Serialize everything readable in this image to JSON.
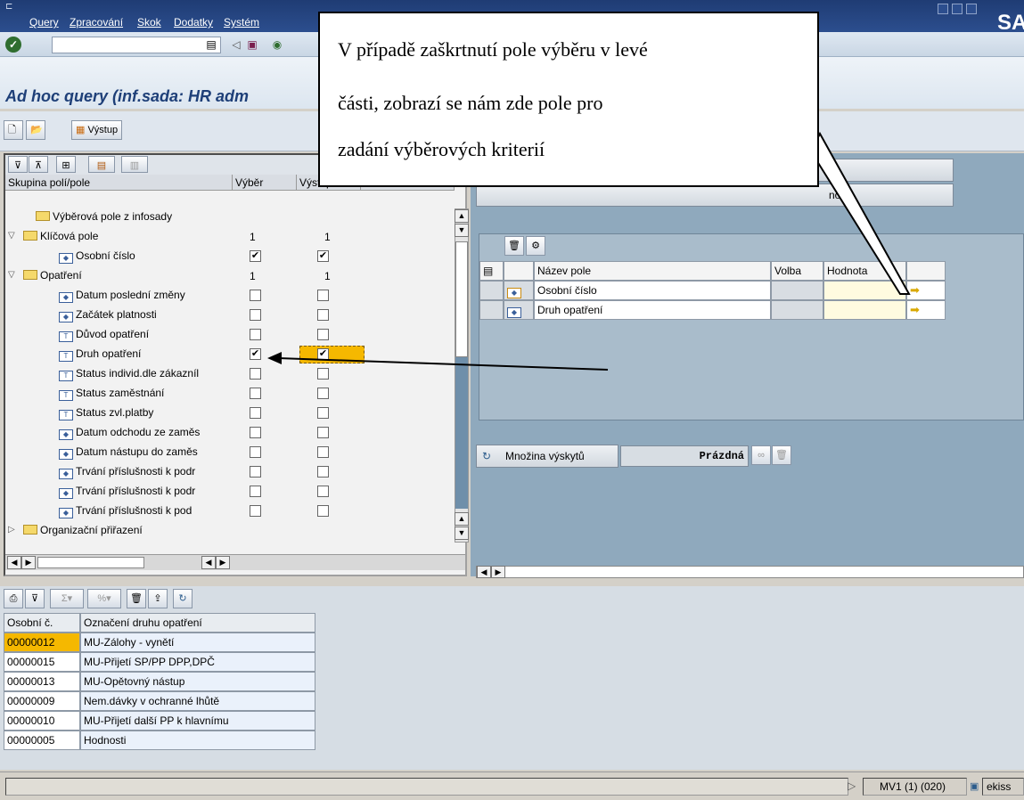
{
  "menubar": {
    "items": [
      "Query",
      "Zpracování",
      "Skok",
      "Dodatky",
      "Systém"
    ],
    "logo": "SA"
  },
  "title": "Ad hoc query (inf.sada: HR adm",
  "app_toolbar": {
    "output_button": "Výstup"
  },
  "left_panel": {
    "columns": [
      "Skupina polí/pole",
      "Výběr",
      "Výstup"
    ],
    "rows": [
      {
        "label": "Výběrová pole z infosady",
        "type": "folder",
        "indent": 1
      },
      {
        "label": "Klíčová pole",
        "type": "folder-open",
        "indent": 0,
        "sel": "1",
        "out": "1"
      },
      {
        "label": "Osobní číslo",
        "type": "field",
        "indent": 2,
        "sel_cb": true,
        "out_cb": true
      },
      {
        "label": "Opatření",
        "type": "folder-open",
        "indent": 0,
        "sel": "1",
        "out": "1"
      },
      {
        "label": "Datum poslední změny",
        "type": "field",
        "indent": 2,
        "sel_cb": false,
        "out_cb": false
      },
      {
        "label": "Začátek platnosti",
        "type": "field",
        "indent": 2,
        "sel_cb": false,
        "out_cb": false
      },
      {
        "label": "Důvod opatření",
        "type": "field-t",
        "indent": 2,
        "sel_cb": false,
        "out_cb": false
      },
      {
        "label": "Druh opatření",
        "type": "field-t",
        "indent": 2,
        "sel_cb": true,
        "out_cb": true
      },
      {
        "label": "Status individ.dle zákazníl",
        "type": "field-t",
        "indent": 2,
        "sel_cb": false,
        "out_cb": false
      },
      {
        "label": "Status zaměstnání",
        "type": "field-t",
        "indent": 2,
        "sel_cb": false,
        "out_cb": false
      },
      {
        "label": "Status zvl.platby",
        "type": "field-t",
        "indent": 2,
        "sel_cb": false,
        "out_cb": false
      },
      {
        "label": "Datum odchodu ze zaměs",
        "type": "field",
        "indent": 2,
        "sel_cb": false,
        "out_cb": false
      },
      {
        "label": "Datum nástupu do zaměs",
        "type": "field",
        "indent": 2,
        "sel_cb": false,
        "out_cb": false
      },
      {
        "label": "Trvání příslušnosti k podr",
        "type": "field",
        "indent": 2,
        "sel_cb": false,
        "out_cb": false
      },
      {
        "label": "Trvání příslušnosti k podr",
        "type": "field",
        "indent": 2,
        "sel_cb": false,
        "out_cb": false
      },
      {
        "label": "Trvání  příslušnosti k pod",
        "type": "field",
        "indent": 2,
        "sel_cb": false,
        "out_cb": false
      },
      {
        "label": "Organizační přiřazení",
        "type": "folder-closed",
        "indent": 0
      }
    ]
  },
  "right_panel": {
    "button2_text": "no",
    "columns": [
      "Název pole",
      "Volba",
      "Hodnota"
    ],
    "rows": [
      "Osobní číslo",
      "Druh opatření"
    ],
    "hitlist_label": "Množina výskytů",
    "hitlist_value": "Prázdná"
  },
  "bottom_table": {
    "columns": [
      "Osobní č.",
      "Označení druhu opatření"
    ],
    "rows": [
      [
        "00000012",
        "MU-Zálohy - vynětí"
      ],
      [
        "00000015",
        "MU-Přijetí SP/PP DPP,DPČ"
      ],
      [
        "00000013",
        "MU-Opětovný nástup"
      ],
      [
        "00000009",
        "Nem.dávky v ochranné lhůtě"
      ],
      [
        "00000010",
        "MU-Přijetí další PP k hlavnímu"
      ],
      [
        "00000005",
        "Hodnosti"
      ]
    ]
  },
  "statusbar": {
    "session": "MV1 (1) (020)",
    "user": "ekiss"
  },
  "callout": {
    "lines": [
      "V případě zaškrtnutí pole výběru v levé",
      "části, zobrazí se nám zde pole pro",
      "zadání výběrových kriterií"
    ]
  },
  "colors": {
    "menubar": "#1f3c74",
    "title": "#1e3f78",
    "right_panel": "#8fa9bd",
    "highlight": "#f5b800"
  }
}
